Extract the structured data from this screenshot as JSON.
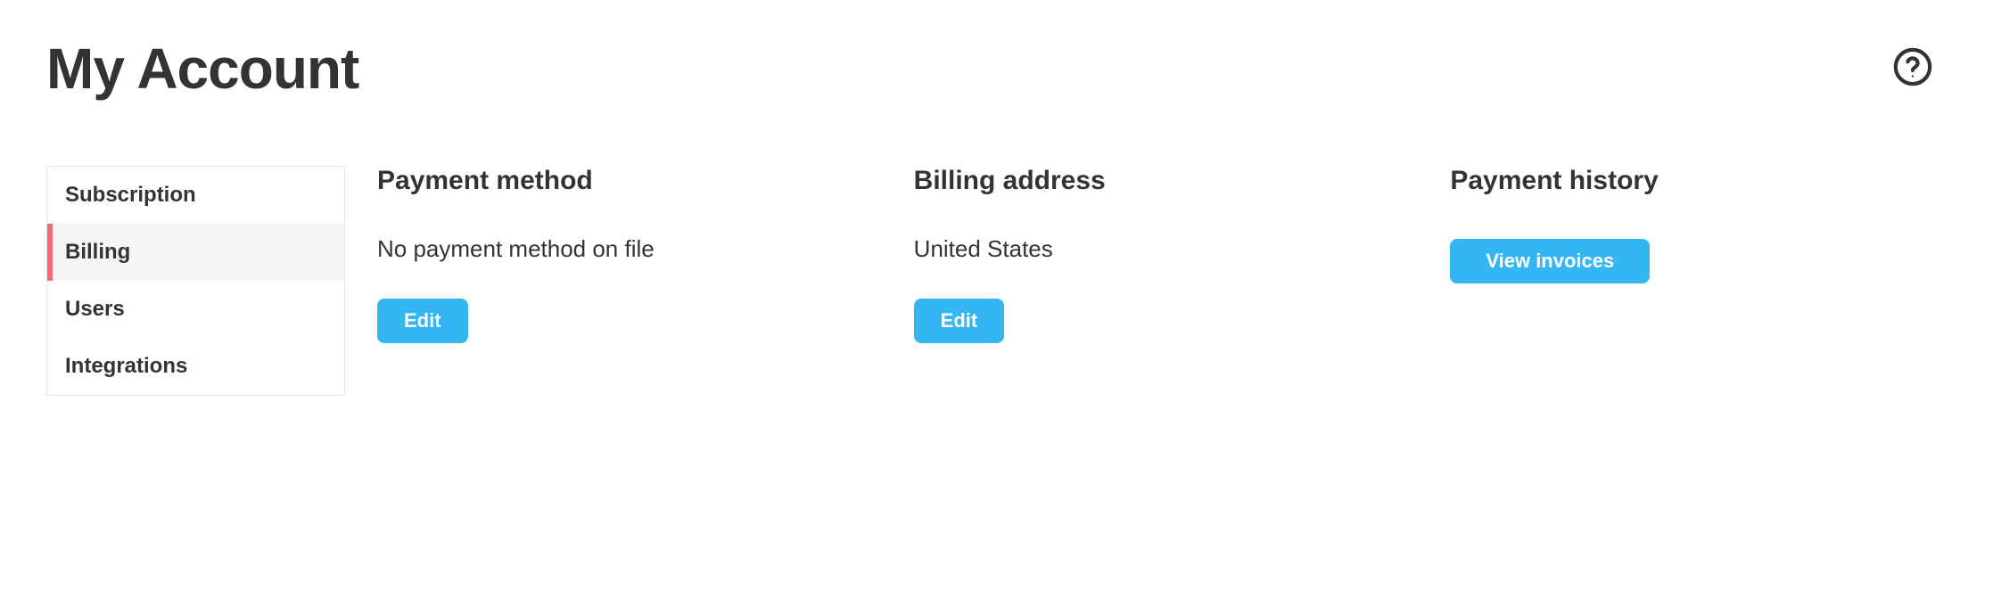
{
  "header": {
    "title": "My Account"
  },
  "sidebar": {
    "items": [
      {
        "label": "Subscription",
        "active": false
      },
      {
        "label": "Billing",
        "active": true
      },
      {
        "label": "Users",
        "active": false
      },
      {
        "label": "Integrations",
        "active": false
      }
    ]
  },
  "sections": {
    "payment_method": {
      "heading": "Payment method",
      "body": "No payment method on file",
      "button": "Edit"
    },
    "billing_address": {
      "heading": "Billing address",
      "body": "United States",
      "button": "Edit"
    },
    "payment_history": {
      "heading": "Payment history",
      "button": "View invoices"
    }
  }
}
